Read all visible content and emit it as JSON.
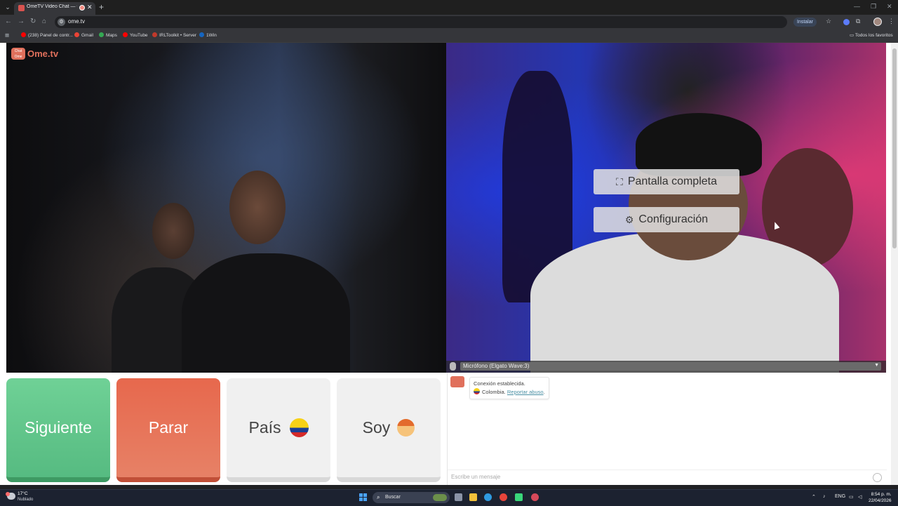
{
  "browser": {
    "tab_title": "OmeTV Video Chat — Ome",
    "tab_close": "✕",
    "new_tab": "+",
    "url": "ome.tv",
    "install_label": "Instalar",
    "all_bookmarks": "Todos los favoritos",
    "bookmarks": [
      {
        "label": "(238) Panel de contr...",
        "color": "#ff0000"
      },
      {
        "label": "Gmail",
        "color": "#ea4335"
      },
      {
        "label": "Maps",
        "color": "#34a853"
      },
      {
        "label": "YouTube",
        "color": "#ff0000"
      },
      {
        "label": "IRLToolkit • Server",
        "color": "#c0392b"
      },
      {
        "label": "1Win",
        "color": "#1565c0"
      }
    ]
  },
  "ometv": {
    "logo_text": "Ome.tv",
    "logo_badge": "Chat Ome",
    "overlay": {
      "fullscreen_label": "Pantalla completa",
      "settings_label": "Configuración"
    },
    "microphone_label": "Micrófono (Elgato Wave:3)",
    "buttons": {
      "next": "Siguiente",
      "stop": "Parar",
      "country": "País",
      "self": "Soy"
    },
    "chat": {
      "line1": "Conexión establecida.",
      "country": "Colombia.",
      "report": "Reportar abuso",
      "report_suffix": ".",
      "placeholder": "Escribe un mensaje"
    }
  },
  "taskbar": {
    "temperature": "17°C",
    "condition": "Nublado",
    "search_label": "Buscar",
    "language": "ENG",
    "time": "8:54 p. m.",
    "date": "22/04/2026"
  }
}
